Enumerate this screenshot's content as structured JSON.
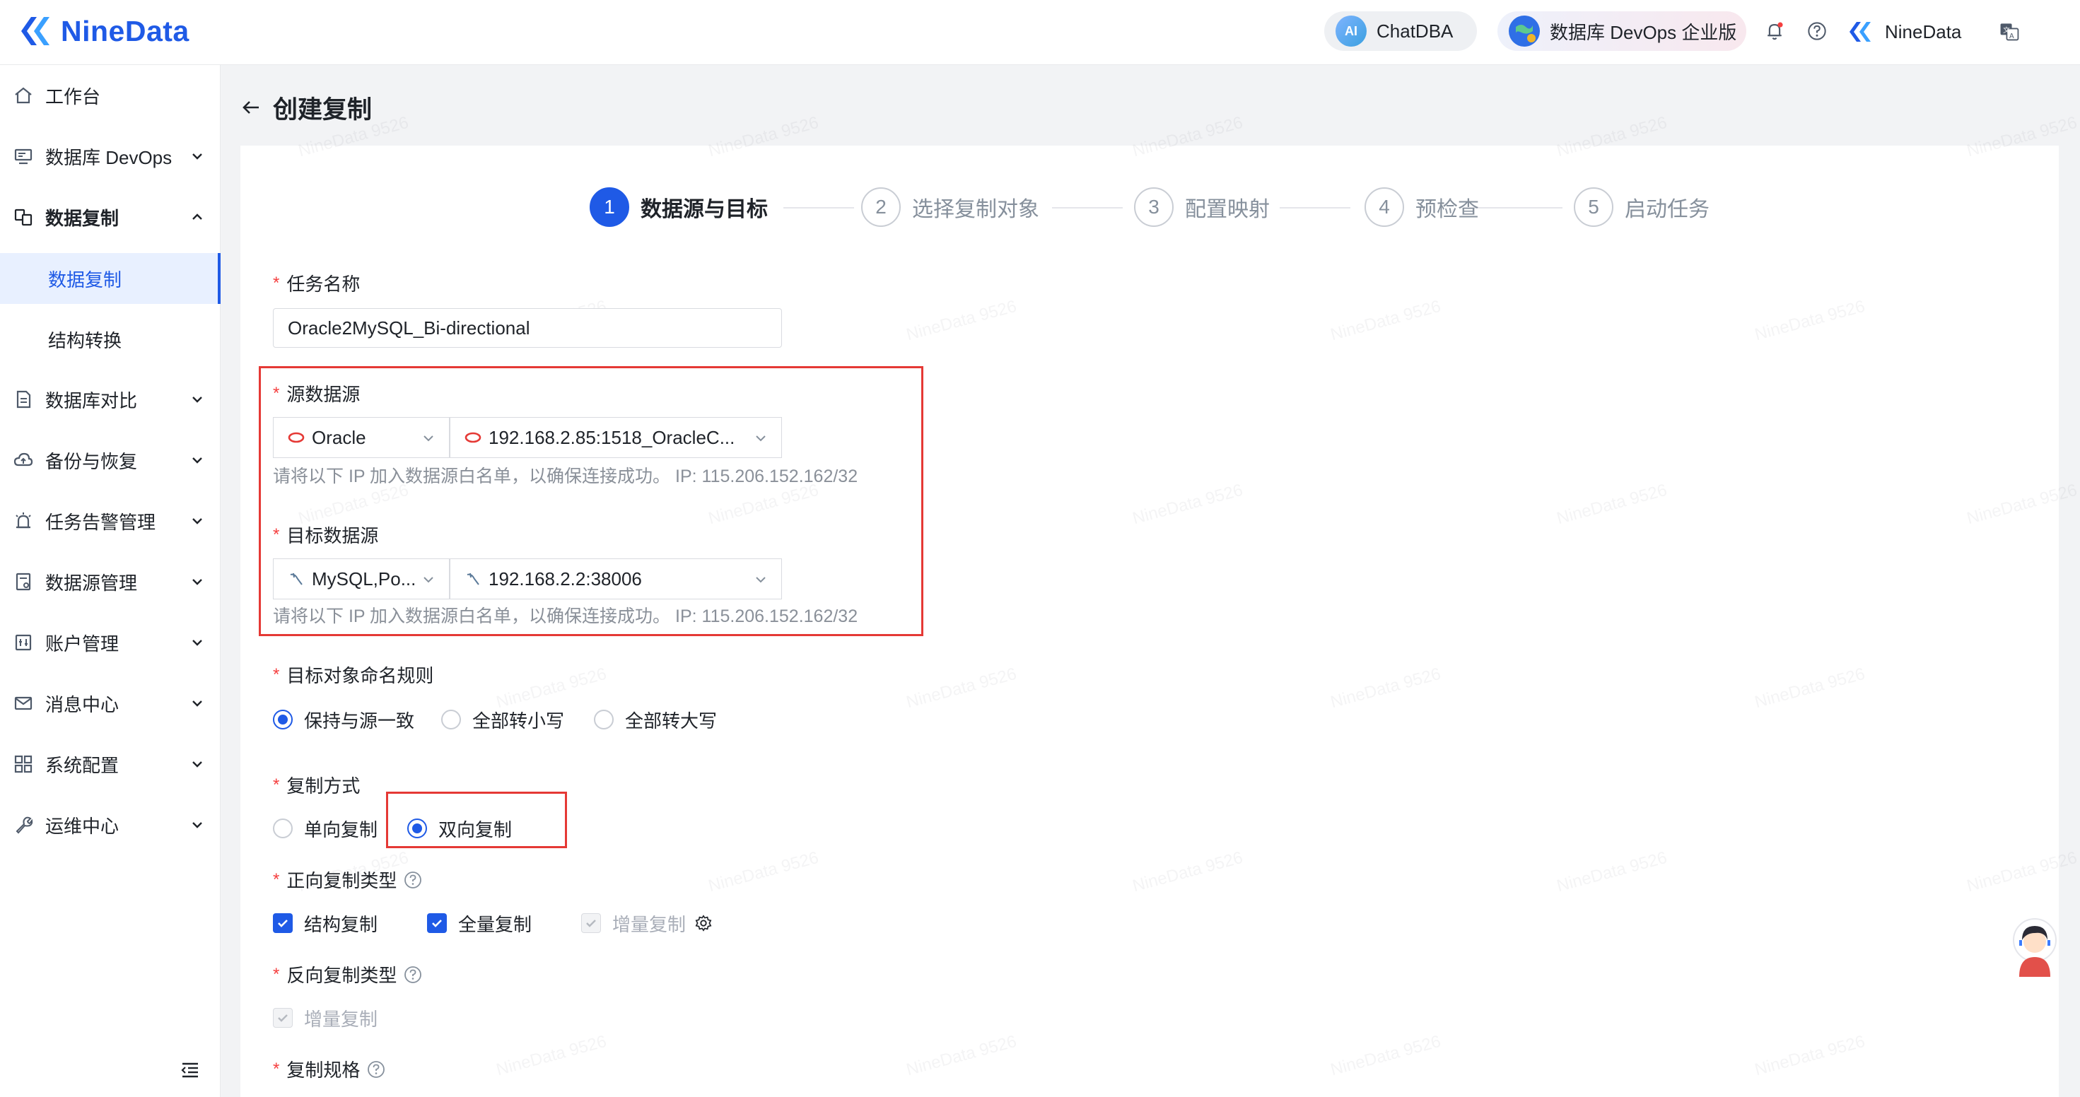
{
  "header": {
    "logo_text": "NineData",
    "chatdba_label": "ChatDBA",
    "chatdba_icon_text": "AI",
    "devops_label": "数据库 DevOps 企业版",
    "user_name": "NineData",
    "icons": [
      "bell-icon",
      "help-icon",
      "translate-icon"
    ],
    "brand_color": "#1f5ae6"
  },
  "sidebar": {
    "items": [
      {
        "label": "工作台",
        "icon": "home-icon"
      },
      {
        "label": "数据库 DevOps",
        "icon": "monitor-icon"
      },
      {
        "label": "数据复制",
        "icon": "replication-icon"
      },
      {
        "label": "数据复制",
        "icon": ""
      },
      {
        "label": "结构转换",
        "icon": ""
      },
      {
        "label": "数据库对比",
        "icon": "compare-icon"
      },
      {
        "label": "备份与恢复",
        "icon": "cloud-icon"
      },
      {
        "label": "任务告警管理",
        "icon": "alarm-icon"
      },
      {
        "label": "数据源管理",
        "icon": "datasource-icon"
      },
      {
        "label": "账户管理",
        "icon": "account-icon"
      },
      {
        "label": "消息中心",
        "icon": "mail-icon"
      },
      {
        "label": "系统配置",
        "icon": "grid-icon"
      },
      {
        "label": "运维中心",
        "icon": "wrench-icon"
      }
    ]
  },
  "page": {
    "title": "创建复制",
    "watermark": "NineData 9526"
  },
  "steps": [
    {
      "num": "1",
      "label": "数据源与目标"
    },
    {
      "num": "2",
      "label": "选择复制对象"
    },
    {
      "num": "3",
      "label": "配置映射"
    },
    {
      "num": "4",
      "label": "预检查"
    },
    {
      "num": "5",
      "label": "启动任务"
    }
  ],
  "form": {
    "required_mark": "*",
    "task_name_label": "任务名称",
    "task_name_value": "Oracle2MySQL_Bi-directional",
    "source_label": "源数据源",
    "source_type": "Oracle",
    "source_instance": "192.168.2.85:1518_OracleC...",
    "source_hint": "请将以下 IP 加入数据源白名单，以确保连接成功。 IP: 115.206.152.162/32",
    "target_label": "目标数据源",
    "target_type": "MySQL,Po...",
    "target_instance": "192.168.2.2:38006",
    "target_hint": "请将以下 IP 加入数据源白名单，以确保连接成功。 IP: 115.206.152.162/32",
    "naming_label": "目标对象命名规则",
    "naming_options": [
      "保持与源一致",
      "全部转小写",
      "全部转大写"
    ],
    "naming_selected": "保持与源一致",
    "mode_label": "复制方式",
    "mode_options": [
      "单向复制",
      "双向复制"
    ],
    "mode_selected": "双向复制",
    "forward_label": "正向复制类型",
    "forward_options": [
      "结构复制",
      "全量复制",
      "增量复制"
    ],
    "reverse_label": "反向复制类型",
    "reverse_options": [
      "增量复制"
    ],
    "spec_label": "复制规格"
  }
}
